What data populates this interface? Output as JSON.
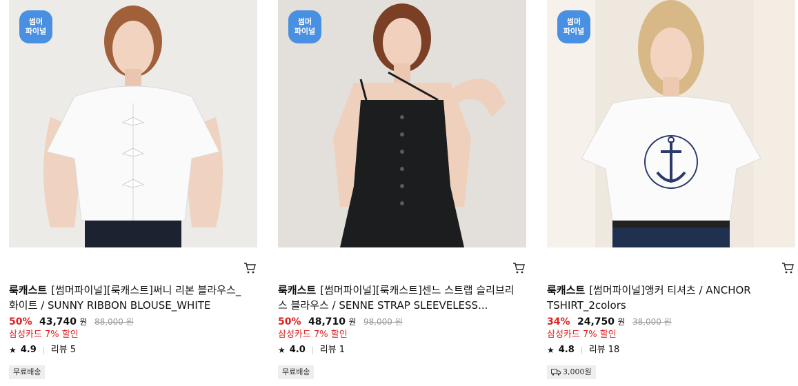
{
  "products": [
    {
      "badge_line1": "썸머",
      "badge_line2": "파이널",
      "brand": "룩캐스트",
      "title": "[썸머파이널][룩캐스트]써니 리본 블라우스_화이트 / SUNNY RIBBON BLOUSE_WHITE",
      "discount": "50%",
      "price": "43,740",
      "currency": "원",
      "original_price": "88,000 원",
      "card_promo": "삼성카드 7% 할인",
      "rating": "4.9",
      "reviews_label": "리뷰",
      "reviews_count": "5",
      "shipping": "무료배송",
      "shipping_icon": null
    },
    {
      "badge_line1": "썸머",
      "badge_line2": "파이널",
      "brand": "룩캐스트",
      "title": "[썸머파이널][룩캐스트]센느 스트랩 슬리브리스 블라우스 / SENNE STRAP SLEEVELESS...",
      "discount": "50%",
      "price": "48,710",
      "currency": "원",
      "original_price": "98,000 원",
      "card_promo": "삼성카드 7% 할인",
      "rating": "4.0",
      "reviews_label": "리뷰",
      "reviews_count": "1",
      "shipping": "무료배송",
      "shipping_icon": null
    },
    {
      "badge_line1": "썸머",
      "badge_line2": "파이널",
      "brand": "룩캐스트",
      "title": "[썸머파이널]앵커 티셔츠 / ANCHOR TSHIRT_2colors",
      "discount": "34%",
      "price": "24,750",
      "currency": "원",
      "original_price": "38,000 원",
      "card_promo": "삼성카드 7% 할인",
      "rating": "4.8",
      "reviews_label": "리뷰",
      "reviews_count": "18",
      "shipping": "3,000원",
      "shipping_icon": "truck-icon"
    }
  ],
  "theme": {
    "badge_color": "#4a90e2",
    "discount_color": "#e02020",
    "tag_bg": "#eeeeee"
  }
}
